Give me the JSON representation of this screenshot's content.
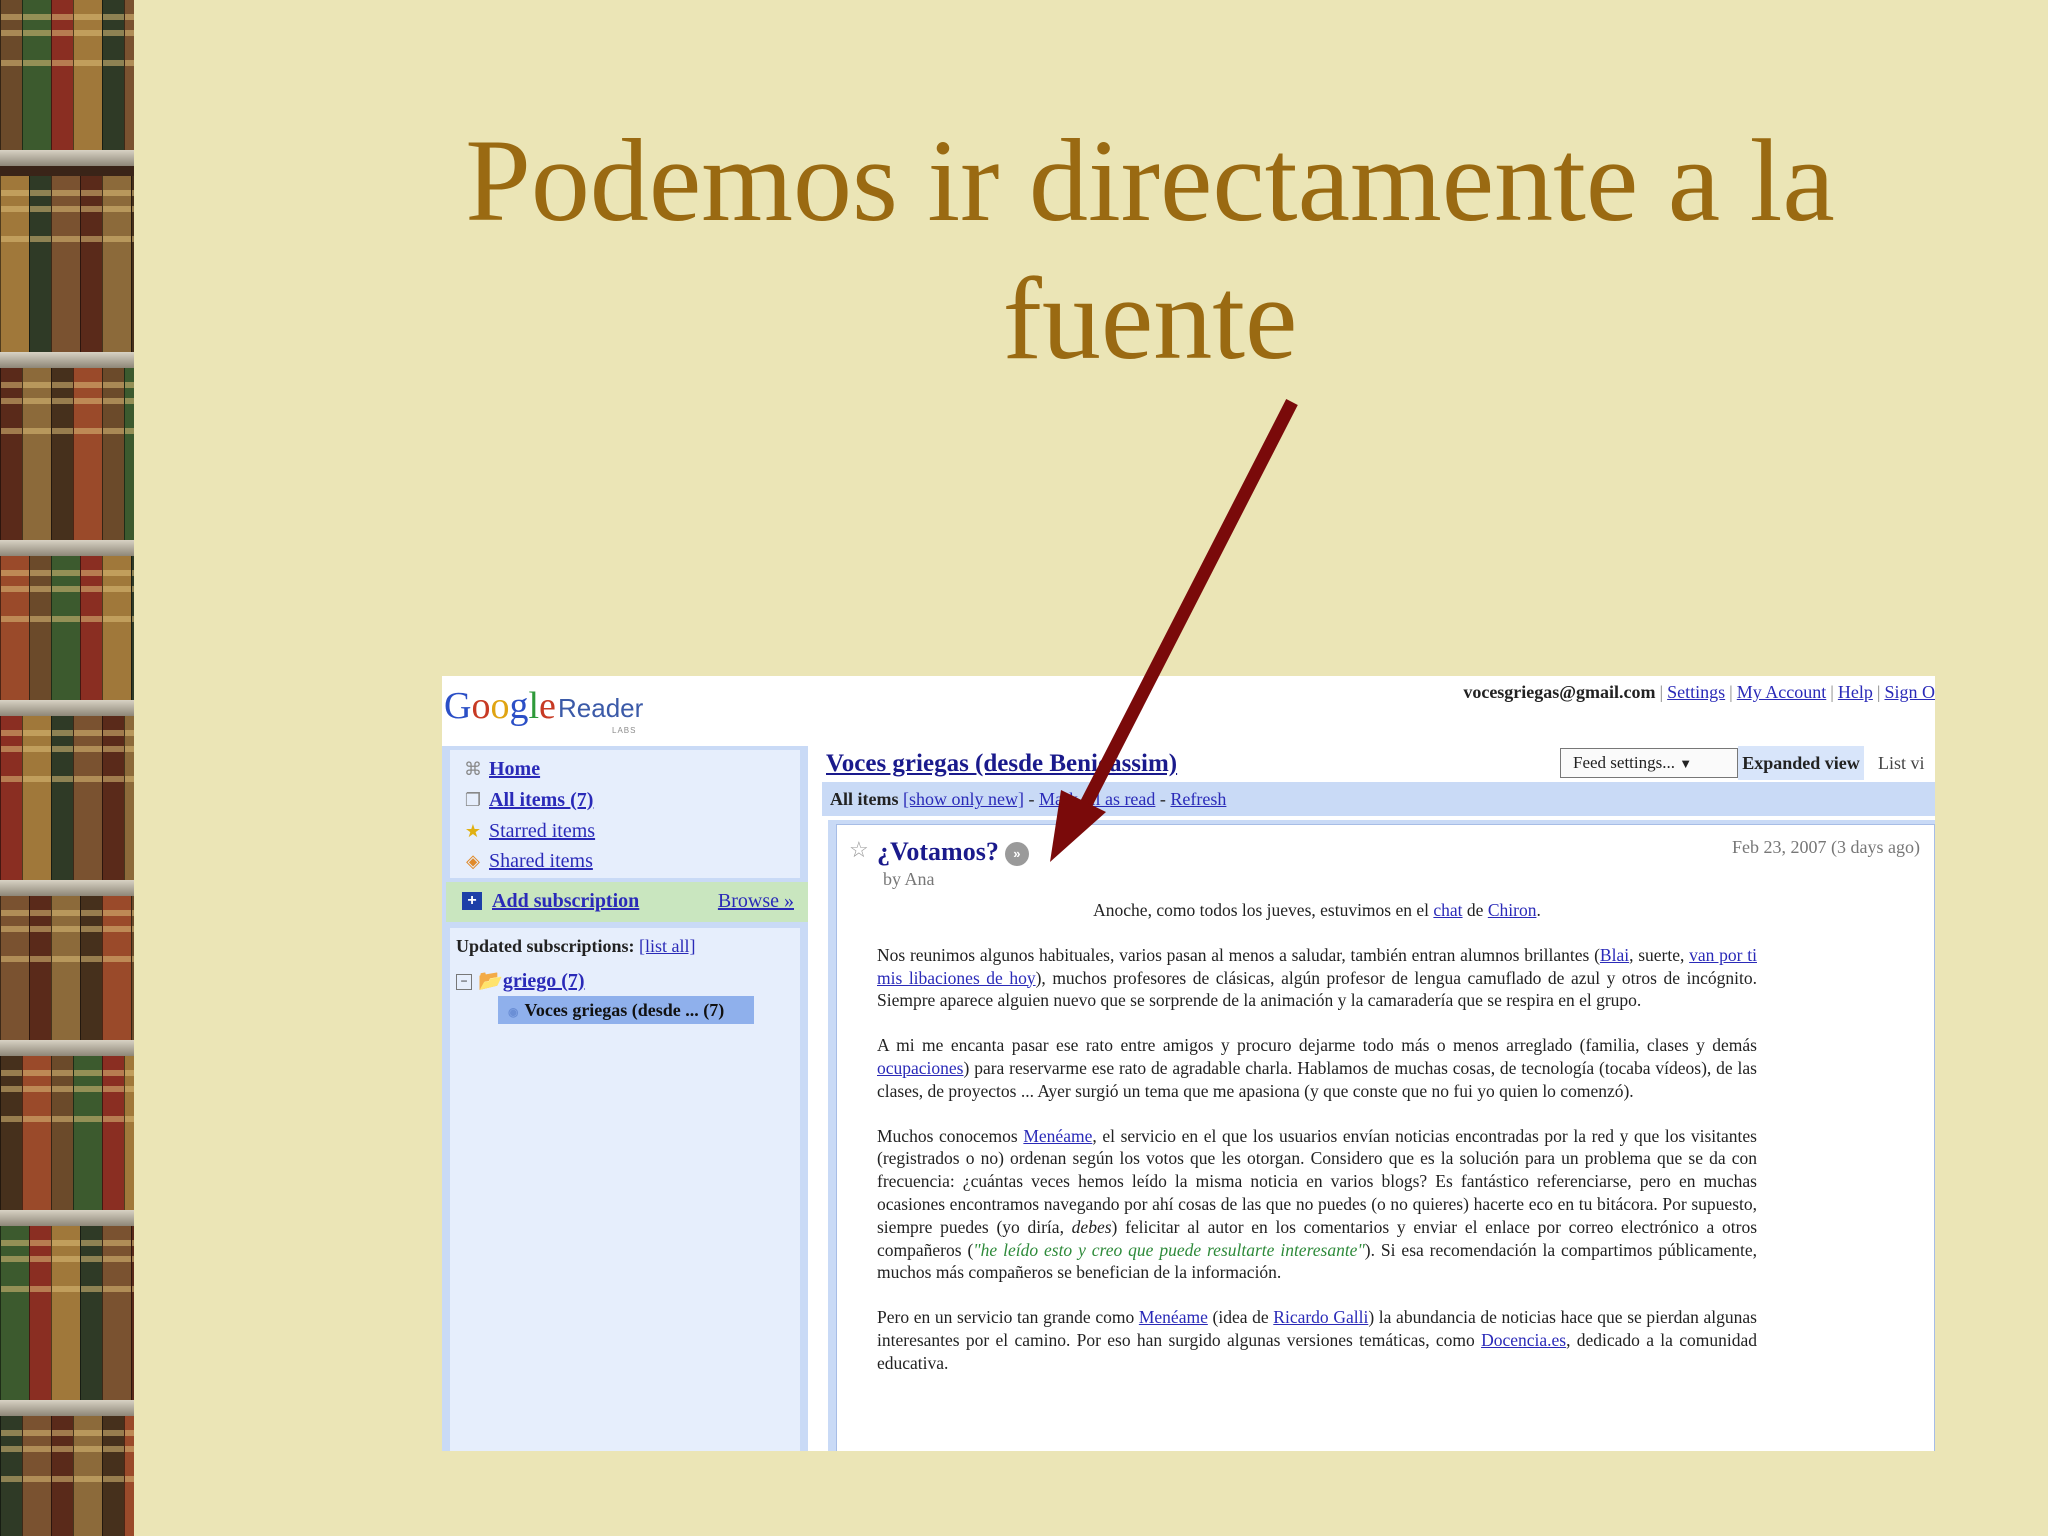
{
  "slide": {
    "title_line1": "Podemos ir directamente a la",
    "title_line2": "fuente"
  },
  "reader": {
    "logo_text": "Google",
    "reader_label": "Reader",
    "labs_label": "LABS",
    "top": {
      "email": "vocesgriegas@gmail.com",
      "settings": "Settings",
      "my_account": "My Account",
      "help": "Help",
      "sign_out": "Sign O"
    },
    "nav": {
      "home": "Home",
      "all_items": "All items (7)",
      "starred": "Starred items",
      "shared": "Shared items"
    },
    "add_subscription": "Add subscription",
    "browse": "Browse »",
    "updated_subscriptions": "Updated subscriptions:",
    "list_all": "[list all]",
    "folder": "griego (7)",
    "feed_item": "Voces griegas (desde ... (7)",
    "feed_title": "Voces griegas (desde Benicàssim)",
    "feed_settings": "Feed settings...",
    "expanded_view": "Expanded view",
    "list_view": "List vi",
    "bar": {
      "all_items": "All items",
      "show_only_new": "[show only new]",
      "sep1": "-",
      "mark_all_read": "Mark all as read",
      "sep2": "-",
      "refresh": "Refresh"
    },
    "entry": {
      "title": "¿Votamos?",
      "goto_icon": "»",
      "date": "Feb 23, 2007 (3 days ago)",
      "author": "by Ana",
      "p0_a": "Anoche, como todos los jueves, estuvimos en el ",
      "p0_chat": "chat",
      "p0_b": " de ",
      "p0_chiron": "Chiron",
      "p0_c": ".",
      "p1_a": "Nos reunimos algunos habituales, varios pasan al menos a saludar, también entran alumnos brillantes (",
      "p1_blai": "Blai",
      "p1_b": ", suerte, ",
      "p1_link": "van por ti mis libaciones de hoy",
      "p1_c": "), muchos profesores de clásicas, algún profesor de lengua camuflado de azul y otros de incógnito. Siempre aparece alguien nuevo que se sorprende de la animación y la camaradería que se respira en el grupo.",
      "p2_a": "A mi me encanta pasar ese rato entre amigos y procuro dejarme todo más o menos arreglado (familia, clases y demás ",
      "p2_link": "ocupaciones",
      "p2_b": ") para reservarme ese rato de agradable charla. Hablamos de muchas cosas, de tecnología (tocaba vídeos), de las clases, de proyectos ... Ayer surgió un tema que me apasiona (y que conste que no fui yo quien lo comenzó).",
      "p3_a": "Muchos conocemos ",
      "p3_meneame": "Menéame",
      "p3_b": ", el servicio en el que los usuarios envían noticias encontradas por la red y que los visitantes (registrados o no) ordenan según los votos que les otorgan. Considero que es la solución para un problema que se da con frecuencia: ¿cuántas veces hemos leído la misma noticia en varios blogs? Es fantástico referenciarse, pero en muchas ocasiones encontramos navegando por ahí cosas de las que no puedes (o no quieres) hacerte eco en tu bitácora. Por supuesto, siempre puedes (yo diría, ",
      "p3_debes": "debes",
      "p3_c": ") felicitar al autor en los comentarios y enviar el enlace por correo electrónico a otros compañeros (",
      "p3_quote": "\"he leído esto y creo que puede resultarte interesante\"",
      "p3_d": "). Si esa recomendación la compartimos públicamente, muchos más compañeros se benefician de la información.",
      "p4_a": "Pero en un servicio tan grande como ",
      "p4_meneame": "Menéame",
      "p4_b": " (idea de ",
      "p4_ricardo": "Ricardo Galli",
      "p4_c": ") la abundancia de noticias hace que se pierdan algunas interesantes por el camino. Por eso han surgido algunas versiones temáticas, como ",
      "p4_docencia": "Docencia.es",
      "p4_d": ", dedicado a la comunidad educativa."
    }
  },
  "colors": {
    "slide_bg": "#ebe5b6",
    "title": "#9a6a12",
    "arrow": "#7a0a0a",
    "sidebar": "#c9daf6"
  }
}
